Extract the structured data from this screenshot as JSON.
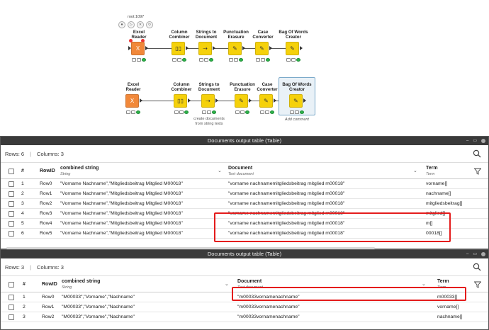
{
  "workflow": {
    "node_id": "root:1097",
    "row1": {
      "nodes": [
        {
          "label": "Excel\nReader",
          "icon": "excel-icon",
          "color": "orange"
        },
        {
          "label": "Column\nCombiner",
          "icon": "column-combiner-icon",
          "color": "yellow"
        },
        {
          "label": "Strings to\nDocument",
          "icon": "strings-to-document-icon",
          "color": "yellow"
        },
        {
          "label": "Punctuation\nErasure",
          "icon": "punctuation-erasure-icon",
          "color": "yellow"
        },
        {
          "label": "Case\nConverter",
          "icon": "case-converter-icon",
          "color": "yellow"
        },
        {
          "label": "Bag Of Words\nCreator",
          "icon": "bag-of-words-icon",
          "color": "yellow"
        }
      ]
    },
    "row2": {
      "nodes": [
        {
          "label": "Excel\nReader",
          "icon": "excel-icon",
          "color": "orange"
        },
        {
          "label": "Column\nCombiner",
          "icon": "column-combiner-icon",
          "color": "yellow"
        },
        {
          "label": "Strings to\nDocument",
          "icon": "strings-to-document-icon",
          "color": "yellow"
        },
        {
          "label": "Punctuation\nErasure",
          "icon": "punctuation-erasure-icon",
          "color": "yellow"
        },
        {
          "label": "Case\nConverter",
          "icon": "case-converter-icon",
          "color": "yellow"
        },
        {
          "label": "Bag Of Words\nCreator",
          "icon": "bag-of-words-icon",
          "color": "yellow"
        }
      ],
      "annotation": "create documents\nfrom string texts",
      "add_comment": "Add comment"
    }
  },
  "table1": {
    "title": "Documents output table (Table)",
    "rows_label": "Rows: 6",
    "columns_label": "Columns: 3",
    "headers": {
      "num": "#",
      "rowid": "RowID",
      "combined": "combined string",
      "combined_type": "String",
      "document": "Document",
      "document_type": "Text document",
      "term": "Term",
      "term_type": "Term"
    },
    "rows": [
      {
        "num": "1",
        "rowid": "Row0",
        "combined": "\"Vorname Nachname\",\"Mitgliedsbeitrag Mitglied M00018\"",
        "document": "\"vorname nachnamemitgliedsbeitrag mitglied m00018\"",
        "term": "vorname[]"
      },
      {
        "num": "2",
        "rowid": "Row1",
        "combined": "\"Vorname Nachname\",\"Mitgliedsbeitrag Mitglied M00018\"",
        "document": "\"vorname nachnamemitgliedsbeitrag mitglied m00018\"",
        "term": "nachname[]"
      },
      {
        "num": "3",
        "rowid": "Row2",
        "combined": "\"Vorname Nachname\",\"Mitgliedsbeitrag Mitglied M00018\"",
        "document": "\"vorname nachnamemitgliedsbeitrag mitglied m00018\"",
        "term": "mitgliedsbeitrag[]"
      },
      {
        "num": "4",
        "rowid": "Row3",
        "combined": "\"Vorname Nachname\",\"Mitgliedsbeitrag Mitglied M00018\"",
        "document": "\"vorname nachnamemitgliedsbeitrag mitglied m00018\"",
        "term": "mitglied[]"
      },
      {
        "num": "5",
        "rowid": "Row4",
        "combined": "\"Vorname Nachname\",\"Mitgliedsbeitrag Mitglied M00018\"",
        "document": "\"vorname nachnamemitgliedsbeitrag mitglied m00018\"",
        "term": "m[]"
      },
      {
        "num": "6",
        "rowid": "Row5",
        "combined": "\"Vorname Nachname\",\"Mitgliedsbeitrag Mitglied M00018\"",
        "document": "\"vorname nachnamemitgliedsbeitrag mitglied m00018\"",
        "term": "00018[]"
      }
    ]
  },
  "table2": {
    "title": "Documents output table (Table)",
    "rows_label": "Rows: 3",
    "columns_label": "Columns: 3",
    "headers": {
      "num": "#",
      "rowid": "RowID",
      "combined": "combined string",
      "combined_type": "String",
      "document": "Document",
      "document_type": "Text document",
      "term": "Term",
      "term_type": "Term"
    },
    "rows": [
      {
        "num": "1",
        "rowid": "Row0",
        "combined": "\"M00033\",\"Vorname\",\"Nachname\"",
        "document": "\"m00033vornamenachname\"",
        "term": "m00033[]"
      },
      {
        "num": "2",
        "rowid": "Row1",
        "combined": "\"M00033\",\"Vorname\",\"Nachname\"",
        "document": "\"m00033vornamenachname\"",
        "term": "vorname[]"
      },
      {
        "num": "3",
        "rowid": "Row2",
        "combined": "\"M00033\",\"Vorname\",\"Nachname\"",
        "document": "\"m00033vornamenachname\"",
        "term": "nachname[]"
      }
    ]
  },
  "colors": {
    "highlight": "#e41b1b",
    "excel_node": "#f1883a",
    "manipulator_node": "#f5d10b",
    "status_ok": "#2db34a"
  }
}
